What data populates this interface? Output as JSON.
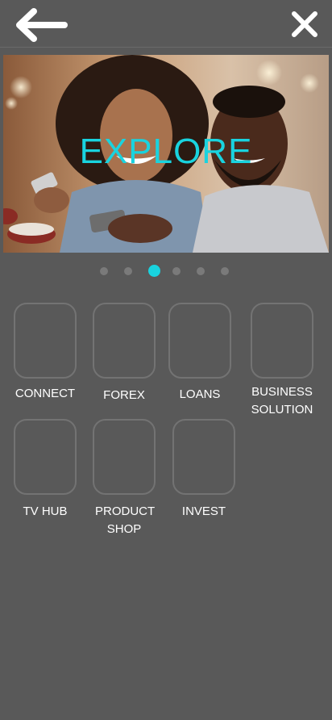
{
  "header": {
    "back_icon": "arrow-left-icon",
    "close_icon": "close-icon"
  },
  "hero": {
    "title": "EXPLORE",
    "accent_color": "#19d3df"
  },
  "carousel": {
    "count": 6,
    "active_index": 2
  },
  "tiles": [
    {
      "label": "CONNECT"
    },
    {
      "label": "FOREX"
    },
    {
      "label": "LOANS"
    },
    {
      "label": "BUSINESS SOLUTION"
    },
    {
      "label": "TV HUB"
    },
    {
      "label": "PRODUCT SHOP"
    },
    {
      "label": "INVEST"
    }
  ],
  "colors": {
    "background": "#595959",
    "tile_border": "#737373",
    "dot_inactive": "#7a7a7a",
    "dot_active": "#19d3df"
  }
}
